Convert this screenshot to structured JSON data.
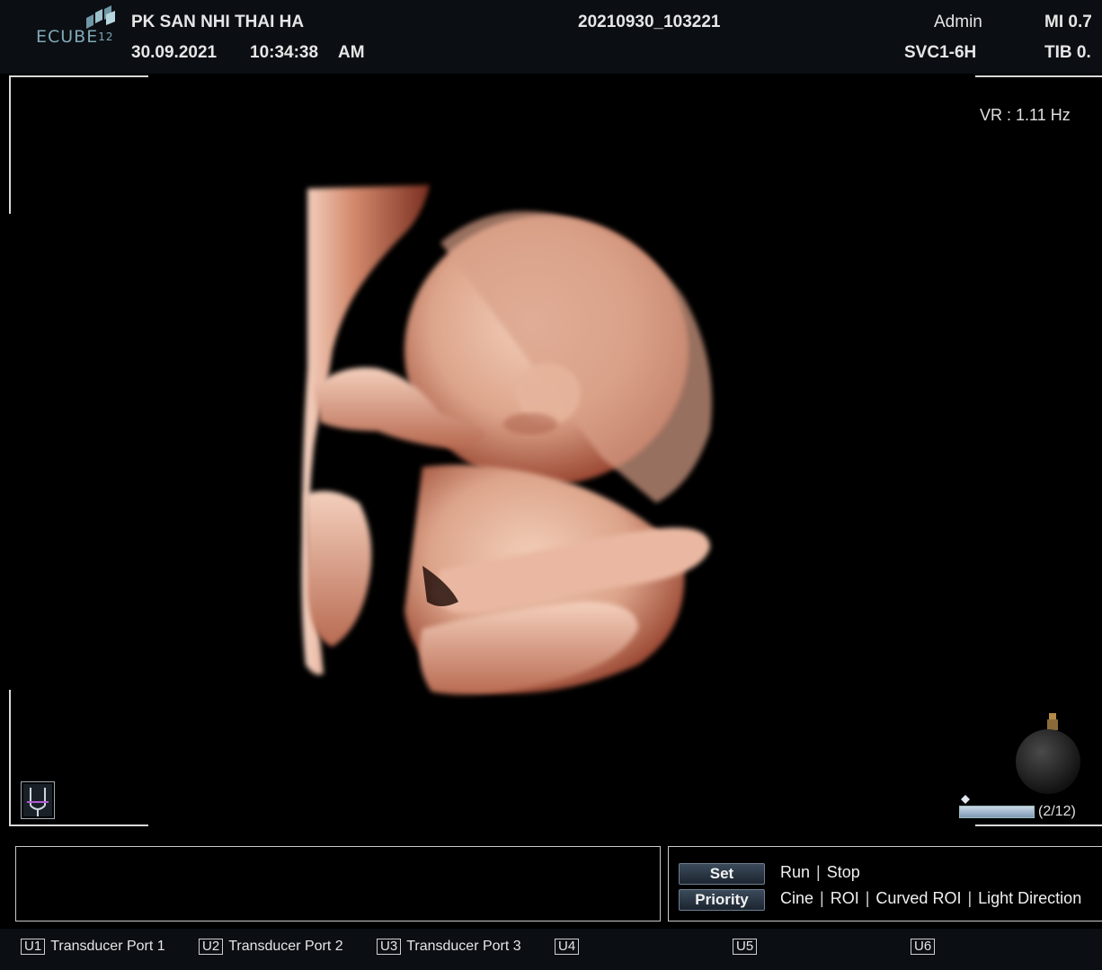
{
  "header": {
    "logo": "ECUBE",
    "logo_model": "12",
    "clinic_name": "PK SAN NHI THAI HA",
    "date": "30.09.2021",
    "time": "10:34:38",
    "ampm": "AM",
    "file_id": "20210930_103221",
    "user": "Admin",
    "probe": "SVC1-6H",
    "mi": "MI 0.7",
    "tib": "TIB 0."
  },
  "image": {
    "volume_rate": "VR : 1.11 Hz",
    "cine_frame": "(2/12)",
    "render_colors": {
      "skin_light": "#f0c6b0",
      "skin_mid": "#d79a80",
      "skin_dark": "#8a3f2c"
    }
  },
  "controls": {
    "set_label": "Set",
    "priority_label": "Priority",
    "set_options": [
      "Run",
      "Stop"
    ],
    "priority_options": [
      "Cine",
      "ROI",
      "Curved ROI",
      "Light Direction"
    ]
  },
  "footer": {
    "keys": [
      {
        "tag": "U1",
        "label": "Transducer Port 1"
      },
      {
        "tag": "U2",
        "label": "Transducer Port 2"
      },
      {
        "tag": "U3",
        "label": "Transducer Port 3"
      },
      {
        "tag": "U4",
        "label": ""
      },
      {
        "tag": "U5",
        "label": ""
      },
      {
        "tag": "U6",
        "label": ""
      }
    ]
  }
}
